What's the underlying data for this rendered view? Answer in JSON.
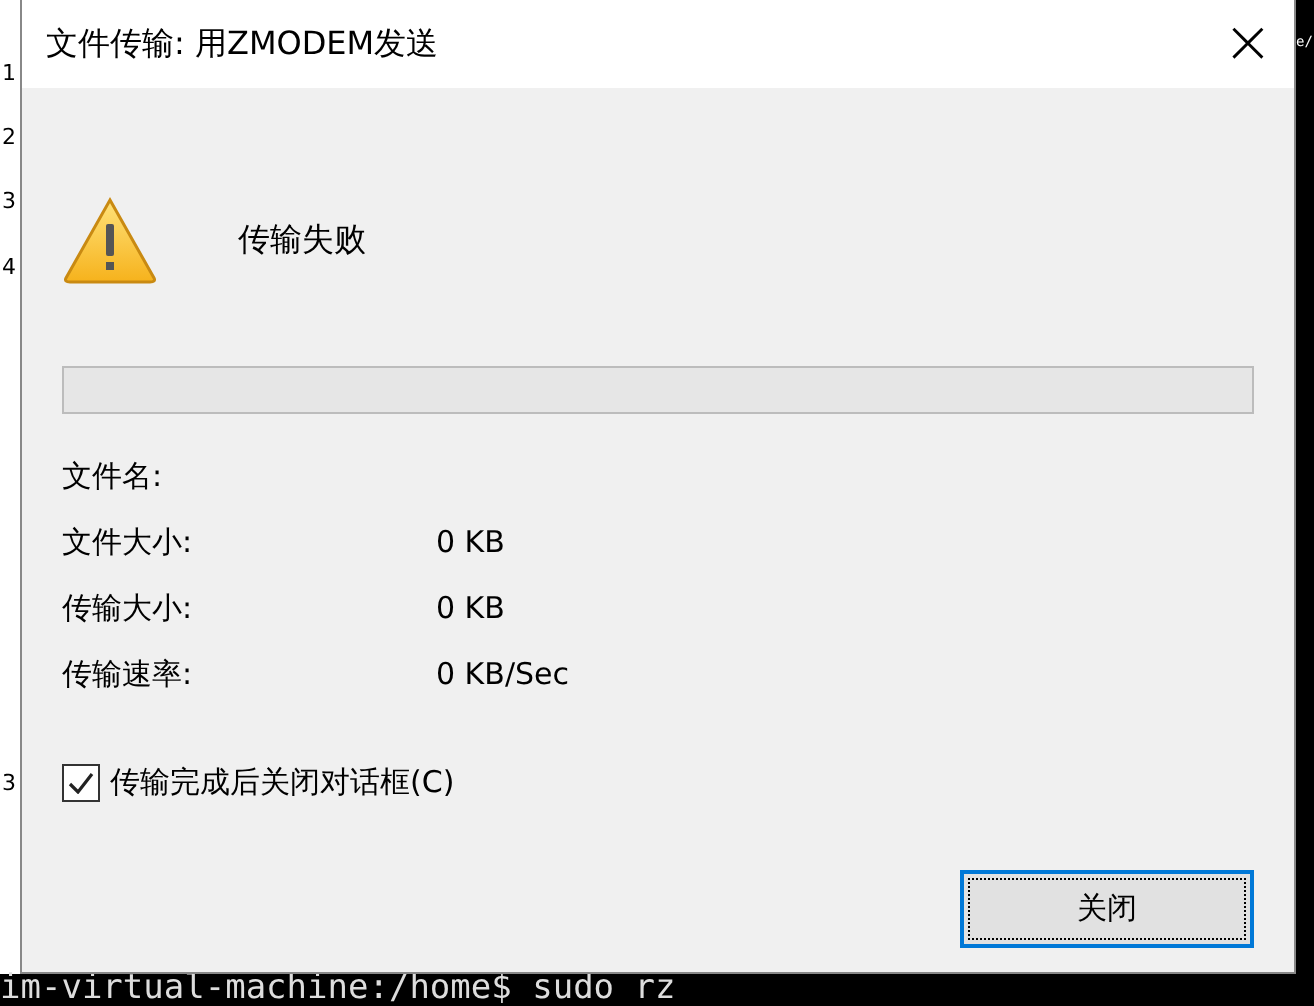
{
  "background": {
    "left_fragments": [
      "1",
      "2",
      "3",
      "4",
      "3"
    ],
    "right_fragment": "e/",
    "terminal_line": "im-virtual-machine:/home$ sudo rz"
  },
  "window": {
    "title": "文件传输: 用ZMODEM发送",
    "close": "×"
  },
  "status": {
    "message": "传输失败"
  },
  "fields": [
    {
      "label": "文件名:"
    },
    {
      "label": "文件大小:",
      "value": "0 KB"
    },
    {
      "label": "传输大小:",
      "value": "0 KB"
    },
    {
      "label": "传输速率:",
      "value": "0 KB/Sec"
    }
  ],
  "close_after": {
    "label": "传输完成后关闭对话框(C)",
    "checked": true
  },
  "buttons": [
    {
      "label": "关闭",
      "selected": true
    }
  ]
}
